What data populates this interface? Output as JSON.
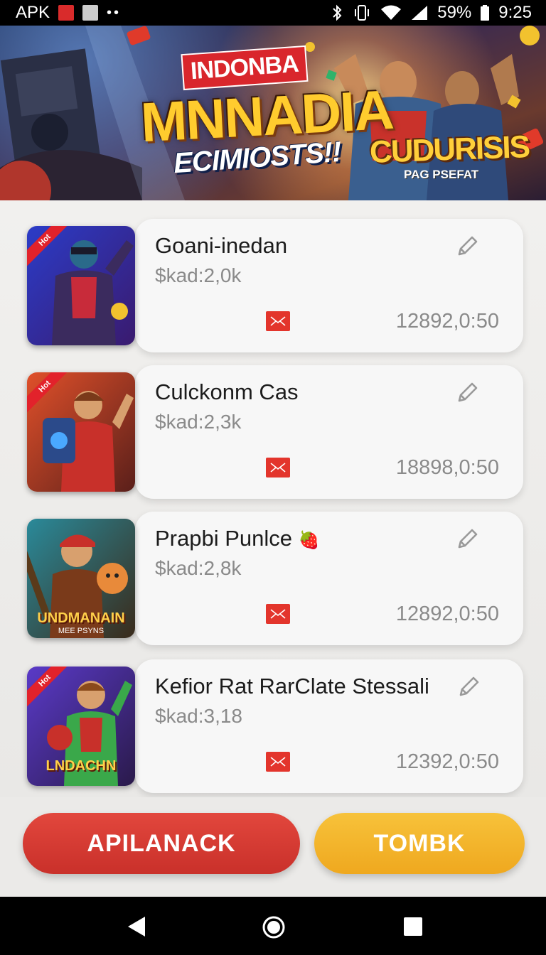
{
  "status_bar": {
    "carrier": "APK",
    "battery": "59%",
    "time": "9:25",
    "icons": [
      "notification-red-icon",
      "notification-gray-icon",
      "more-dots-icon",
      "bluetooth-icon",
      "vibrate-icon",
      "wifi-icon",
      "signal-icon",
      "battery-icon"
    ]
  },
  "banner": {
    "tag": "INDONBA",
    "title": "MNNADIA",
    "subtitle": "ECIMIOSTS!!",
    "badge": "CUDURISIS",
    "badge_sub": "PAG PSEFAT"
  },
  "items": [
    {
      "title": "Goani-inedan",
      "price": "$kad:2,0k",
      "time": "12892,0:50",
      "ribbon": "Hot",
      "caption": "",
      "caption_sub": "",
      "emoji": ""
    },
    {
      "title": "Culckonm Cas",
      "price": "$kad:2,3k",
      "time": "18898,0:50",
      "ribbon": "Hot",
      "caption": "",
      "caption_sub": "",
      "emoji": ""
    },
    {
      "title": "Prapbi Punlce",
      "price": "$kad:2,8k",
      "time": "12892,0:50",
      "ribbon": "",
      "caption": "UNDMANAIN",
      "caption_sub": "MEE PSYNS",
      "emoji": "🍓"
    },
    {
      "title": "Kefior Rat RarClate Stessali",
      "price": "$kad:3,18",
      "time": "12392,0:50",
      "ribbon": "Hot",
      "caption": "LNDACHN",
      "caption_sub": "",
      "emoji": ""
    }
  ],
  "buttons": {
    "primary": "APILANACK",
    "secondary": "TOMBK"
  },
  "nav": {
    "icons": [
      "back-icon",
      "home-icon",
      "recents-icon"
    ]
  }
}
